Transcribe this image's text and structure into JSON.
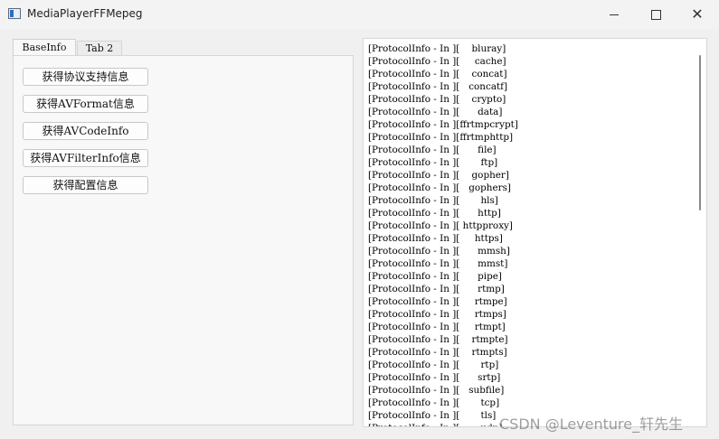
{
  "window": {
    "title": "MediaPlayerFFMepeg"
  },
  "tabs": [
    {
      "label": "BaseInfo"
    },
    {
      "label": "Tab 2"
    }
  ],
  "buttons": [
    {
      "label": "获得协议支持信息"
    },
    {
      "label": "获得AVFormat信息"
    },
    {
      "label": "获得AVCodeInfo"
    },
    {
      "label": "获得AVFilterInfo信息"
    },
    {
      "label": "获得配置信息"
    }
  ],
  "output": {
    "lines": [
      "[ProtocolInfo - In ][    bluray]",
      "[ProtocolInfo - In ][     cache]",
      "[ProtocolInfo - In ][    concat]",
      "[ProtocolInfo - In ][   concatf]",
      "[ProtocolInfo - In ][    crypto]",
      "[ProtocolInfo - In ][      data]",
      "[ProtocolInfo - In ][ffrtmpcrypt]",
      "[ProtocolInfo - In ][ffrtmphttp]",
      "[ProtocolInfo - In ][      file]",
      "[ProtocolInfo - In ][       ftp]",
      "[ProtocolInfo - In ][    gopher]",
      "[ProtocolInfo - In ][   gophers]",
      "[ProtocolInfo - In ][       hls]",
      "[ProtocolInfo - In ][      http]",
      "[ProtocolInfo - In ][ httpproxy]",
      "[ProtocolInfo - In ][     https]",
      "[ProtocolInfo - In ][      mmsh]",
      "[ProtocolInfo - In ][      mmst]",
      "[ProtocolInfo - In ][      pipe]",
      "[ProtocolInfo - In ][      rtmp]",
      "[ProtocolInfo - In ][     rtmpe]",
      "[ProtocolInfo - In ][     rtmps]",
      "[ProtocolInfo - In ][     rtmpt]",
      "[ProtocolInfo - In ][    rtmpte]",
      "[ProtocolInfo - In ][    rtmpts]",
      "[ProtocolInfo - In ][       rtp]",
      "[ProtocolInfo - In ][      srtp]",
      "[ProtocolInfo - In ][   subfile]",
      "[ProtocolInfo - In ][       tcp]",
      "[ProtocolInfo - In ][       tls]",
      "[ProtocolInfo - In ][       udp]"
    ]
  },
  "watermark": "CSDN @Leventure_轩先生"
}
